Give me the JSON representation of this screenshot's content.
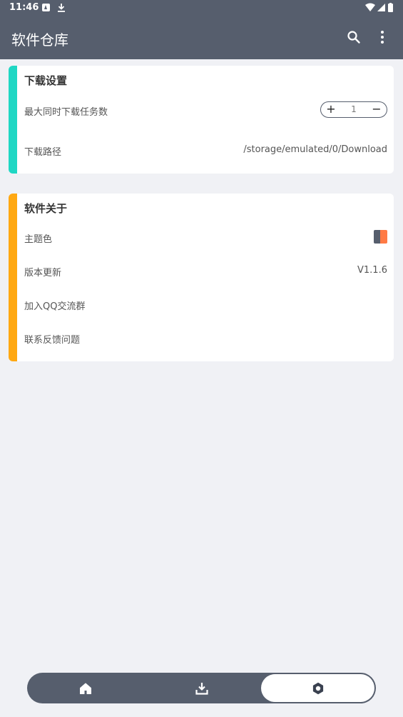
{
  "status_bar": {
    "time": "11:46"
  },
  "app_bar": {
    "title": "软件仓库",
    "icons": [
      "search-icon",
      "more-vert-icon"
    ]
  },
  "download_settings": {
    "title": "下载设置",
    "accent_color": "#1fd7c4",
    "max_tasks": {
      "label": "最大同时下载任务数",
      "value": "1"
    },
    "path": {
      "label": "下载路径",
      "value": "/storage/emulated/0/Download"
    }
  },
  "about": {
    "title": "软件关于",
    "accent_color": "#ffa812",
    "theme": {
      "label": "主题色",
      "swatch_colors": [
        "#565e6d",
        "#ff7a45"
      ]
    },
    "version": {
      "label": "版本更新",
      "value": "V1.1.6"
    },
    "qq_group": {
      "label": "加入QQ交流群"
    },
    "feedback": {
      "label": "联系反馈问题"
    }
  },
  "bottom_nav": {
    "items": [
      {
        "icon": "home-icon",
        "active": false
      },
      {
        "icon": "download-icon",
        "active": false
      },
      {
        "icon": "settings-icon",
        "active": true
      }
    ]
  }
}
